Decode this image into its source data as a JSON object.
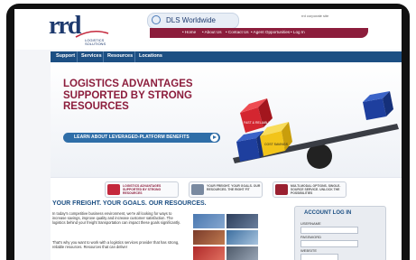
{
  "header": {
    "logo_mark": "rrd",
    "logo_sub": "LOGISTICS SOLUTIONS",
    "search_text": "DLS Worldwide",
    "corporate_link": "rrd corporate site",
    "top_links": [
      "• Home",
      "• About Us",
      "• Contact Us",
      "• Agent Opportunities",
      "• Log In"
    ]
  },
  "main_nav": [
    "Support",
    "Services",
    "Resources",
    "Locations"
  ],
  "hero": {
    "title_lines": [
      "LOGISTICS ADVANTAGES",
      "SUPPORTED BY STRONG",
      "RESOURCES"
    ],
    "button_label": "LEARN ABOUT LEVERAGED-PLATFORM BENEFITS",
    "cube_labels": [
      "FAST & RELIABLE",
      "COST SAVINGS"
    ]
  },
  "features": [
    {
      "text": "LOGISTICS ADVANTAGES SUPPORTED BY STRONG RESOURCES",
      "color": "#c4283c"
    },
    {
      "text": "YOUR FREIGHT. YOUR GOALS. OUR RESOURCES. THE RIGHT FIT",
      "color": "#7a8aa0"
    },
    {
      "text": "MULTI-MODAL OPTIONS. SINGLE-SOURCE SERVICE. UNLOCK THE POSSIBILITIES",
      "color": "#9a2030"
    }
  ],
  "content": {
    "title": "YOUR FREIGHT. YOUR GOALS. OUR RESOURCES.",
    "paragraph1": "In today's competitive business environment, we're all looking for ways to increase savings, improve quality and increase customer satisfaction. The logistics behind your freight transportation can impact these goals significantly.",
    "paragraph2": "That's why you want to work with a logistics services provider that has strong, reliable resources. Resources that can deliver"
  },
  "login": {
    "title": "ACCOUNT LOG IN",
    "username_label": "USERNAME",
    "password_label": "PASSWORD",
    "website_label": "WEBSITE"
  },
  "colors": {
    "brand_navy": "#1e3a6e",
    "brand_maroon": "#8c1d3c",
    "nav_blue": "#1c4f83",
    "button_blue": "#2f6ea8"
  }
}
